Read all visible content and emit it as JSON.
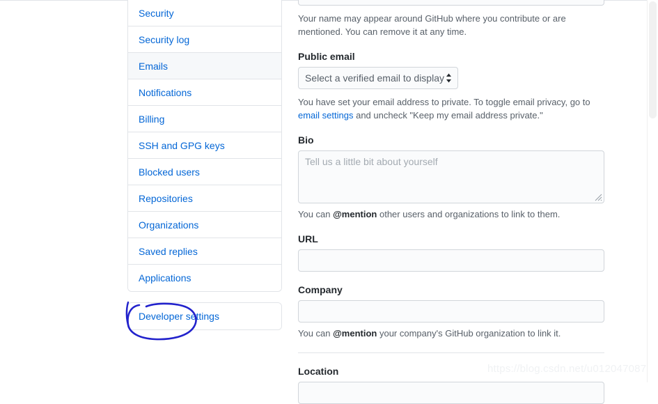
{
  "sidebar": {
    "items": [
      {
        "label": "Security",
        "selected": false
      },
      {
        "label": "Security log",
        "selected": false
      },
      {
        "label": "Emails",
        "selected": true
      },
      {
        "label": "Notifications",
        "selected": false
      },
      {
        "label": "Billing",
        "selected": false
      },
      {
        "label": "SSH and GPG keys",
        "selected": false
      },
      {
        "label": "Blocked users",
        "selected": false
      },
      {
        "label": "Repositories",
        "selected": false
      },
      {
        "label": "Organizations",
        "selected": false
      },
      {
        "label": "Saved replies",
        "selected": false
      },
      {
        "label": "Applications",
        "selected": false
      }
    ],
    "developer_settings": {
      "label": "Developer settings"
    },
    "annotation": {
      "shape": "hand-drawn-ellipse",
      "color": "#2222cc",
      "targets": "Developer settings"
    }
  },
  "main": {
    "name_help_line1": "Your name may appear around GitHub where you contribute or are mentioned. You can",
    "name_help_line2": "remove it at any time.",
    "public_email": {
      "label": "Public email",
      "selected_option": "Select a verified email to display",
      "help_prefix": "You have set your email address to private. To toggle email privacy, go to ",
      "help_link": "email settings",
      "help_suffix": " and uncheck \"Keep my email address private.\""
    },
    "bio": {
      "label": "Bio",
      "placeholder": "Tell us a little bit about yourself",
      "value": "",
      "help_prefix": "You can ",
      "help_strong": "@mention",
      "help_suffix": " other users and organizations to link to them."
    },
    "url": {
      "label": "URL",
      "value": ""
    },
    "company": {
      "label": "Company",
      "value": "",
      "help_prefix": "You can ",
      "help_strong": "@mention",
      "help_suffix": " your company's GitHub organization to link it."
    },
    "location": {
      "label": "Location",
      "value": ""
    }
  },
  "watermark": {
    "text": "https://blog.csdn.net/u012047087"
  },
  "colors": {
    "link": "#0366d6",
    "text": "#24292e",
    "muted": "#586069",
    "border": "#e1e4e8",
    "input_bg": "#fafbfc",
    "selected_bg": "#f6f8fa",
    "annotation": "#2222cc"
  }
}
